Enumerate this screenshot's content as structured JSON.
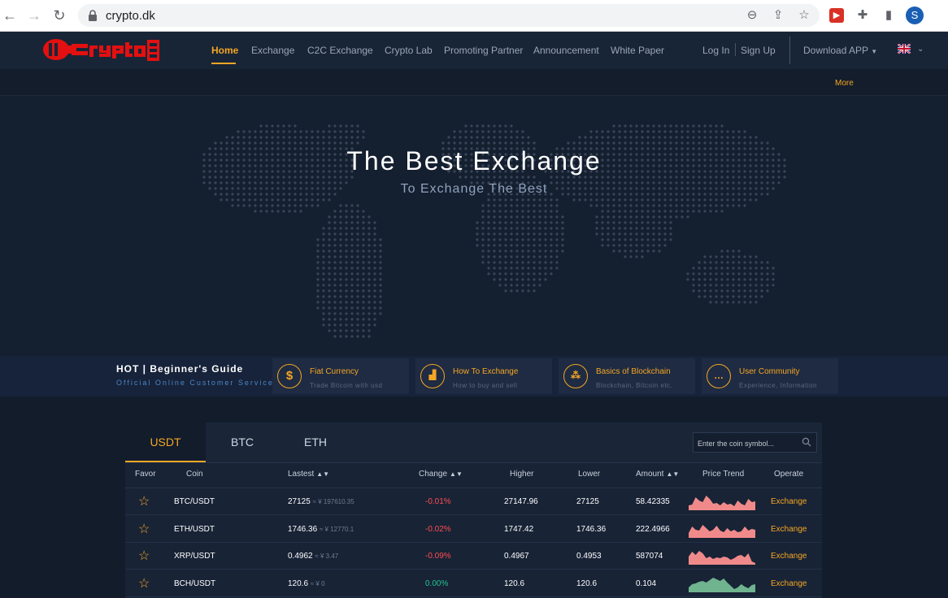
{
  "browser": {
    "url": "crypto.dk",
    "avatar_letter": "S"
  },
  "header": {
    "nav": [
      {
        "label": "Home"
      },
      {
        "label": "Exchange"
      },
      {
        "label": "C2C Exchange"
      },
      {
        "label": "Crypto Lab"
      },
      {
        "label": "Promoting Partner"
      },
      {
        "label": "Announcement"
      },
      {
        "label": "White Paper"
      }
    ],
    "login": "Log In",
    "signup": "Sign Up",
    "download": "Download APP",
    "more": "More"
  },
  "hero": {
    "title": "The Best Exchange",
    "subtitle": "To Exchange The Best"
  },
  "guide": {
    "title": "HOT | Beginner's Guide",
    "subtitle": "Official Online Customer Service",
    "cards": [
      {
        "icon": "dollar-icon",
        "title": "Fiat Currency",
        "sub": "Trade Bitcoin with usd"
      },
      {
        "icon": "chart-icon",
        "title": "How To Exchange",
        "sub": "How to buy and sell"
      },
      {
        "icon": "network-icon",
        "title": "Basics of Blockchain",
        "sub": "Blockchain, Bitcoin etc."
      },
      {
        "icon": "chat-icon",
        "title": "User Community",
        "sub": "Experience, Information"
      }
    ]
  },
  "market": {
    "tabs": [
      "USDT",
      "BTC",
      "ETH"
    ],
    "search_placeholder": "Enter the coin symbol...",
    "columns": {
      "favor": "Favor",
      "coin": "Coin",
      "lastest": "Lastest",
      "change": "Change",
      "higher": "Higher",
      "lower": "Lower",
      "amount": "Amount",
      "trend": "Price Trend",
      "operate": "Operate"
    },
    "rows": [
      {
        "coin": "BTC/USDT",
        "last": "27125",
        "cny": "≈ ¥ 197610.35",
        "change": "-0.01%",
        "dir": "neg",
        "high": "27147.96",
        "low": "27125",
        "amount": "58.42335",
        "op": "Exchange",
        "trend_color": "#f08a8a",
        "trend": [
          0.3,
          0.35,
          0.8,
          0.6,
          0.5,
          0.9,
          0.7,
          0.4,
          0.45,
          0.3,
          0.5,
          0.35,
          0.4,
          0.25,
          0.6,
          0.4,
          0.3,
          0.7,
          0.5,
          0.55
        ]
      },
      {
        "coin": "ETH/USDT",
        "last": "1746.36",
        "cny": "≈ ¥ 12770.1",
        "change": "-0.02%",
        "dir": "neg",
        "high": "1747.42",
        "low": "1746.36",
        "amount": "222.4966",
        "op": "Exchange",
        "trend_color": "#f08a8a",
        "trend": [
          0.3,
          0.7,
          0.5,
          0.45,
          0.8,
          0.6,
          0.4,
          0.5,
          0.75,
          0.45,
          0.35,
          0.6,
          0.4,
          0.5,
          0.35,
          0.4,
          0.7,
          0.45,
          0.55,
          0.5
        ]
      },
      {
        "coin": "XRP/USDT",
        "last": "0.4962",
        "cny": "≈ ¥ 3.47",
        "change": "-0.09%",
        "dir": "neg",
        "high": "0.4967",
        "low": "0.4953",
        "amount": "587074",
        "op": "Exchange",
        "trend_color": "#f08a8a",
        "trend": [
          0.5,
          0.8,
          0.6,
          0.85,
          0.7,
          0.4,
          0.5,
          0.35,
          0.45,
          0.4,
          0.5,
          0.45,
          0.3,
          0.4,
          0.55,
          0.6,
          0.45,
          0.7,
          0.2,
          0.1
        ]
      },
      {
        "coin": "BCH/USDT",
        "last": "120.6",
        "cny": "≈ ¥ 0",
        "change": "0.00%",
        "dir": "pos",
        "high": "120.6",
        "low": "120.6",
        "amount": "0.104",
        "op": "Exchange",
        "trend_color": "#6fb38f",
        "trend": [
          0.3,
          0.5,
          0.55,
          0.65,
          0.7,
          0.6,
          0.75,
          0.9,
          0.8,
          0.7,
          0.85,
          0.6,
          0.4,
          0.2,
          0.3,
          0.5,
          0.35,
          0.25,
          0.45,
          0.5
        ]
      }
    ]
  }
}
